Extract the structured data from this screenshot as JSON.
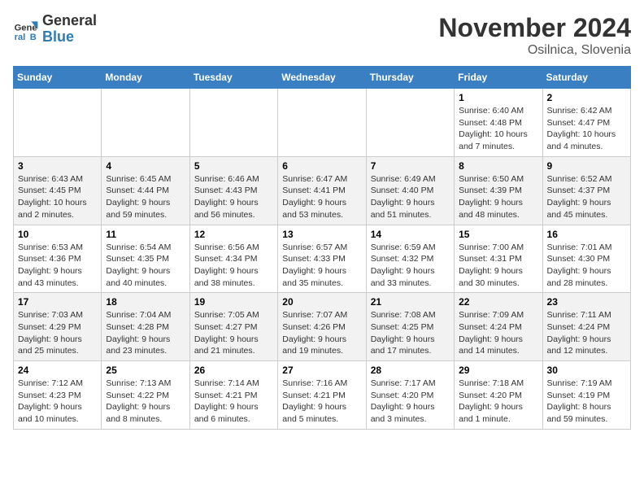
{
  "header": {
    "logo_general": "General",
    "logo_blue": "Blue",
    "month_title": "November 2024",
    "location": "Osilnica, Slovenia"
  },
  "weekdays": [
    "Sunday",
    "Monday",
    "Tuesday",
    "Wednesday",
    "Thursday",
    "Friday",
    "Saturday"
  ],
  "weeks": [
    [
      {
        "day": "",
        "info": ""
      },
      {
        "day": "",
        "info": ""
      },
      {
        "day": "",
        "info": ""
      },
      {
        "day": "",
        "info": ""
      },
      {
        "day": "",
        "info": ""
      },
      {
        "day": "1",
        "info": "Sunrise: 6:40 AM\nSunset: 4:48 PM\nDaylight: 10 hours and 7 minutes."
      },
      {
        "day": "2",
        "info": "Sunrise: 6:42 AM\nSunset: 4:47 PM\nDaylight: 10 hours and 4 minutes."
      }
    ],
    [
      {
        "day": "3",
        "info": "Sunrise: 6:43 AM\nSunset: 4:45 PM\nDaylight: 10 hours and 2 minutes."
      },
      {
        "day": "4",
        "info": "Sunrise: 6:45 AM\nSunset: 4:44 PM\nDaylight: 9 hours and 59 minutes."
      },
      {
        "day": "5",
        "info": "Sunrise: 6:46 AM\nSunset: 4:43 PM\nDaylight: 9 hours and 56 minutes."
      },
      {
        "day": "6",
        "info": "Sunrise: 6:47 AM\nSunset: 4:41 PM\nDaylight: 9 hours and 53 minutes."
      },
      {
        "day": "7",
        "info": "Sunrise: 6:49 AM\nSunset: 4:40 PM\nDaylight: 9 hours and 51 minutes."
      },
      {
        "day": "8",
        "info": "Sunrise: 6:50 AM\nSunset: 4:39 PM\nDaylight: 9 hours and 48 minutes."
      },
      {
        "day": "9",
        "info": "Sunrise: 6:52 AM\nSunset: 4:37 PM\nDaylight: 9 hours and 45 minutes."
      }
    ],
    [
      {
        "day": "10",
        "info": "Sunrise: 6:53 AM\nSunset: 4:36 PM\nDaylight: 9 hours and 43 minutes."
      },
      {
        "day": "11",
        "info": "Sunrise: 6:54 AM\nSunset: 4:35 PM\nDaylight: 9 hours and 40 minutes."
      },
      {
        "day": "12",
        "info": "Sunrise: 6:56 AM\nSunset: 4:34 PM\nDaylight: 9 hours and 38 minutes."
      },
      {
        "day": "13",
        "info": "Sunrise: 6:57 AM\nSunset: 4:33 PM\nDaylight: 9 hours and 35 minutes."
      },
      {
        "day": "14",
        "info": "Sunrise: 6:59 AM\nSunset: 4:32 PM\nDaylight: 9 hours and 33 minutes."
      },
      {
        "day": "15",
        "info": "Sunrise: 7:00 AM\nSunset: 4:31 PM\nDaylight: 9 hours and 30 minutes."
      },
      {
        "day": "16",
        "info": "Sunrise: 7:01 AM\nSunset: 4:30 PM\nDaylight: 9 hours and 28 minutes."
      }
    ],
    [
      {
        "day": "17",
        "info": "Sunrise: 7:03 AM\nSunset: 4:29 PM\nDaylight: 9 hours and 25 minutes."
      },
      {
        "day": "18",
        "info": "Sunrise: 7:04 AM\nSunset: 4:28 PM\nDaylight: 9 hours and 23 minutes."
      },
      {
        "day": "19",
        "info": "Sunrise: 7:05 AM\nSunset: 4:27 PM\nDaylight: 9 hours and 21 minutes."
      },
      {
        "day": "20",
        "info": "Sunrise: 7:07 AM\nSunset: 4:26 PM\nDaylight: 9 hours and 19 minutes."
      },
      {
        "day": "21",
        "info": "Sunrise: 7:08 AM\nSunset: 4:25 PM\nDaylight: 9 hours and 17 minutes."
      },
      {
        "day": "22",
        "info": "Sunrise: 7:09 AM\nSunset: 4:24 PM\nDaylight: 9 hours and 14 minutes."
      },
      {
        "day": "23",
        "info": "Sunrise: 7:11 AM\nSunset: 4:24 PM\nDaylight: 9 hours and 12 minutes."
      }
    ],
    [
      {
        "day": "24",
        "info": "Sunrise: 7:12 AM\nSunset: 4:23 PM\nDaylight: 9 hours and 10 minutes."
      },
      {
        "day": "25",
        "info": "Sunrise: 7:13 AM\nSunset: 4:22 PM\nDaylight: 9 hours and 8 minutes."
      },
      {
        "day": "26",
        "info": "Sunrise: 7:14 AM\nSunset: 4:21 PM\nDaylight: 9 hours and 6 minutes."
      },
      {
        "day": "27",
        "info": "Sunrise: 7:16 AM\nSunset: 4:21 PM\nDaylight: 9 hours and 5 minutes."
      },
      {
        "day": "28",
        "info": "Sunrise: 7:17 AM\nSunset: 4:20 PM\nDaylight: 9 hours and 3 minutes."
      },
      {
        "day": "29",
        "info": "Sunrise: 7:18 AM\nSunset: 4:20 PM\nDaylight: 9 hours and 1 minute."
      },
      {
        "day": "30",
        "info": "Sunrise: 7:19 AM\nSunset: 4:19 PM\nDaylight: 8 hours and 59 minutes."
      }
    ]
  ]
}
